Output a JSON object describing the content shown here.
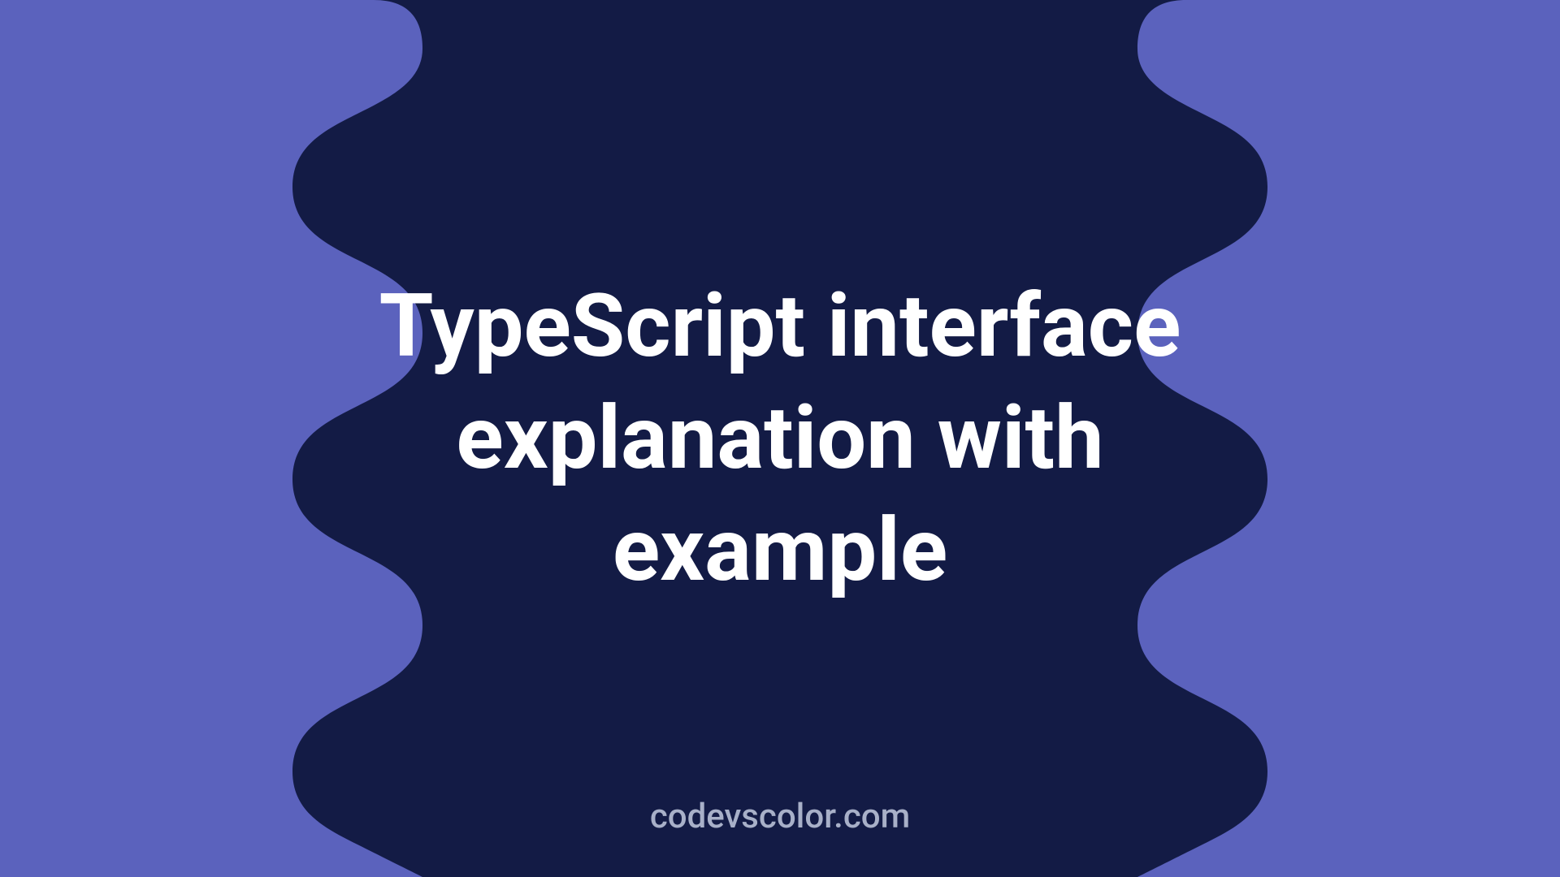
{
  "title": "TypeScript interface explanation with example",
  "footer": "codevscolor.com",
  "colors": {
    "background": "#5b62bd",
    "blob": "#131b45",
    "title": "#ffffff",
    "footer": "#a8b0c8"
  }
}
